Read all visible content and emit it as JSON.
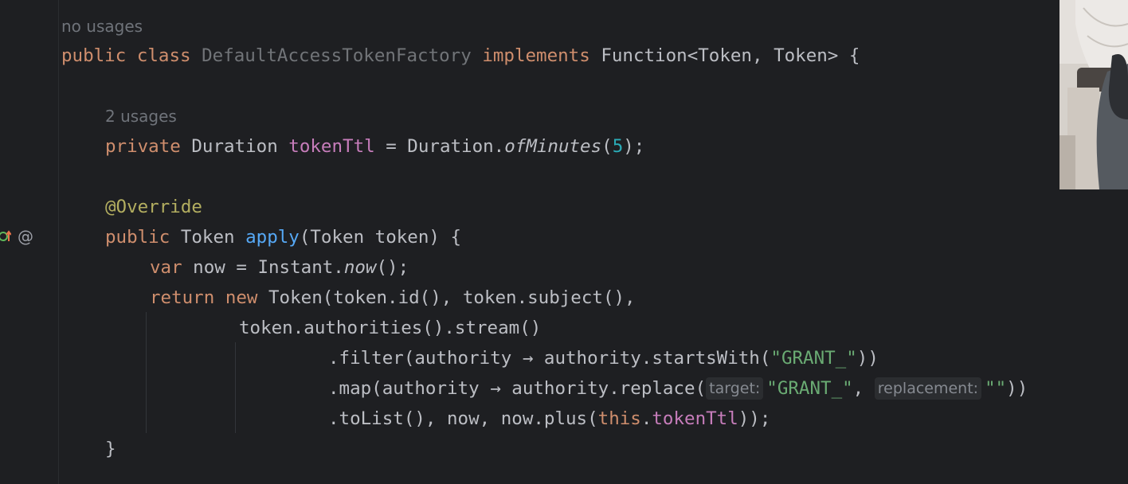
{
  "hints": {
    "class_usages": "no usages",
    "field_usages": "2 usages",
    "target_label": "target:",
    "replacement_label": "replacement:"
  },
  "gutter": {
    "at_symbol": "@"
  },
  "code": {
    "public": "public",
    "class": "class",
    "class_name": "DefaultAccessTokenFactory",
    "implements": "implements",
    "class_tail": " Function<Token, Token> {",
    "private": "private",
    "duration_type": " Duration ",
    "field_name": "tokenTtl",
    "eq_duration": " = Duration.",
    "of_minutes": "ofMinutes",
    "paren_open": "(",
    "minutes_value": "5",
    "paren_close_semi": ");",
    "override": "@Override",
    "token_type": " Token ",
    "method_name": "apply",
    "method_params": "(Token token) {",
    "var": "var",
    "now_assign": " now = Instant.",
    "now_call": "now",
    "now_tail": "();",
    "return": "return",
    "new": "new",
    "token_ctor": " Token(token.id(), token.subject(),",
    "stream_line": "token.authorities().stream()",
    "filter_head": ".filter(authority → authority.startsWith(",
    "grant_literal": "\"GRANT_\"",
    "filter_tail": "))",
    "map_head": ".map(authority → authority.replace(",
    "comma": ", ",
    "empty_literal": "\"\"",
    "map_tail": "))",
    "tolist_head": ".toList(), now, now.plus(",
    "this_kw": "this",
    "dot": ".",
    "tolist_tail": "));",
    "close_brace": "}"
  },
  "colors": {
    "background": "#1e1f22",
    "keyword": "#cf8e6d",
    "field": "#c77dbb",
    "string": "#6aab73",
    "number": "#2aacb8",
    "annotation": "#b3ae60",
    "method_declaration": "#56a8f5",
    "default_text": "#bcbec4"
  }
}
